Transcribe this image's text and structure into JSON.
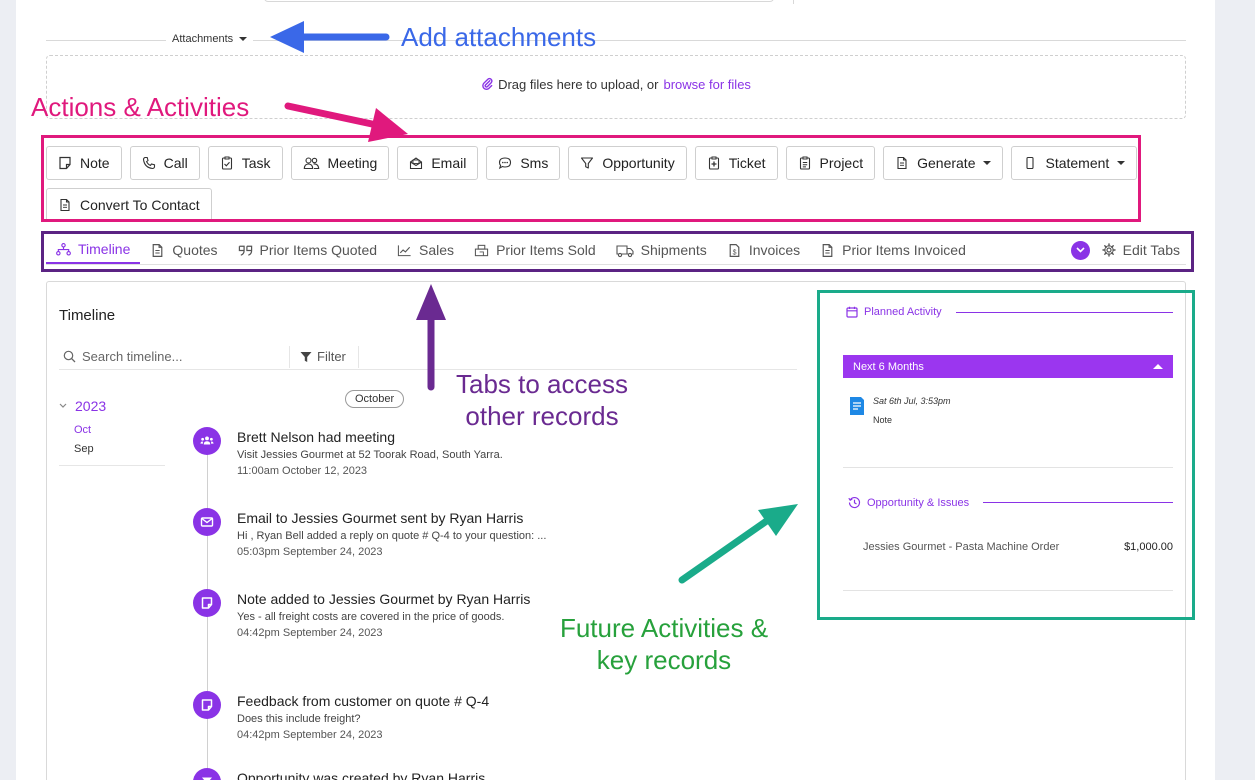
{
  "attachments": {
    "label": "Attachments",
    "drop_text": "Drag files here to upload, or",
    "browse_link": "browse for files"
  },
  "annotations": {
    "add_attachments": "Add attachments",
    "actions_activities": "Actions & Activities",
    "tabs_line1": "Tabs to access",
    "tabs_line2": "other records",
    "future_line1": "Future Activities &",
    "future_line2": "key records"
  },
  "actions": [
    {
      "label": "Note",
      "icon": "note-icon"
    },
    {
      "label": "Call",
      "icon": "phone-icon"
    },
    {
      "label": "Task",
      "icon": "clipboard-check-icon"
    },
    {
      "label": "Meeting",
      "icon": "users-icon"
    },
    {
      "label": "Email",
      "icon": "envelope-open-icon"
    },
    {
      "label": "Sms",
      "icon": "chat-icon"
    },
    {
      "label": "Opportunity",
      "icon": "funnel-icon"
    },
    {
      "label": "Ticket",
      "icon": "ticket-icon"
    },
    {
      "label": "Project",
      "icon": "clipboard-list-icon"
    },
    {
      "label": "Generate",
      "icon": "document-icon"
    },
    {
      "label": "Statement",
      "icon": "mobile-icon"
    },
    {
      "label": "Convert To Contact",
      "icon": "document-icon"
    }
  ],
  "tabs": [
    {
      "label": "Timeline",
      "icon": "timeline-icon",
      "active": true
    },
    {
      "label": "Quotes",
      "icon": "document-icon"
    },
    {
      "label": "Prior Items Quoted",
      "icon": "quote-icon"
    },
    {
      "label": "Sales",
      "icon": "chart-line-icon"
    },
    {
      "label": "Prior Items Sold",
      "icon": "store-icon"
    },
    {
      "label": "Shipments",
      "icon": "truck-icon"
    },
    {
      "label": "Invoices",
      "icon": "invoice-icon"
    },
    {
      "label": "Prior Items Invoiced",
      "icon": "document-icon"
    }
  ],
  "edit_tabs_label": "Edit Tabs",
  "timeline": {
    "title": "Timeline",
    "search_placeholder": "Search timeline...",
    "filter_label": "Filter",
    "year": "2023",
    "months": [
      "Oct",
      "Sep"
    ],
    "month_pill": "October",
    "events": [
      {
        "title": "Brett Nelson had meeting",
        "detail": "Visit Jessies Gourmet at 52 Toorak Road, South Yarra.",
        "time": "11:00am October 12, 2023",
        "icon": "users-icon"
      },
      {
        "title": "Email to Jessies Gourmet sent by Ryan Harris",
        "detail": "Hi , Ryan Bell added a reply on quote # Q-4 to your question: ...",
        "time": "05:03pm September 24, 2023",
        "icon": "envelope-icon"
      },
      {
        "title": "Note added to Jessies Gourmet by Ryan Harris",
        "detail": "Yes - all freight costs are covered in the price of goods.",
        "time": "04:42pm September 24, 2023",
        "icon": "note-icon"
      },
      {
        "title": "Feedback from customer on quote # Q-4",
        "detail": "Does this include freight?",
        "time": "04:42pm September 24, 2023",
        "icon": "note-icon"
      },
      {
        "title": "Opportunity was created by Ryan Harris",
        "detail": "",
        "time": "",
        "icon": "funnel-icon"
      }
    ]
  },
  "right_panel": {
    "planned_label": "Planned Activity",
    "next_label": "Next 6 Months",
    "activity_date": "Sat 6th Jul, 3:53pm",
    "activity_type": "Note",
    "opp_label": "Opportunity & Issues",
    "opp_name": "Jessies Gourmet - Pasta Machine Order",
    "opp_amount": "$1,000.00"
  },
  "colors": {
    "accent": "#8a33e6",
    "pink": "#e0197d",
    "purple_box": "#5b2383",
    "green_box": "#1aab8a",
    "blue_arrow": "#3a68e8"
  }
}
